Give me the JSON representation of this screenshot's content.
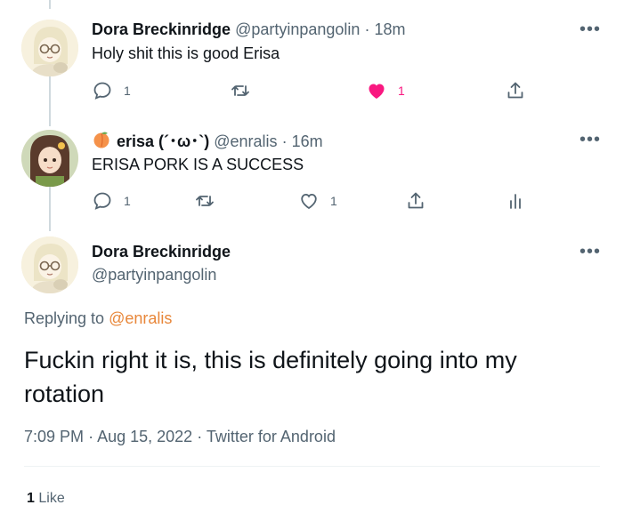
{
  "tweets": [
    {
      "name": "Dora Breckinridge",
      "handle": "@partyinpangolin",
      "time": "18m",
      "text": "Holy shit this is good Erisa",
      "replies": "1",
      "likes": "1",
      "liked": true
    },
    {
      "name": "erisa (´･ω･`)",
      "handle": "@enralis",
      "time": "16m",
      "text": "ERISA PORK IS A SUCCESS",
      "replies": "1",
      "likes": "1",
      "liked": false
    }
  ],
  "focused": {
    "name": "Dora Breckinridge",
    "handle": "@partyinpangolin",
    "replying_prefix": "Replying to",
    "replying_to": "@enralis",
    "text": "Fuckin right it is, this is definitely going into my rotation",
    "time": "7:09 PM",
    "date": "Aug 15, 2022",
    "source": "Twitter for Android",
    "like_count": "1",
    "like_label": "Like"
  },
  "separator": "·",
  "more": "•••",
  "colors": {
    "like_active": "#f91880",
    "mention": "#e8873a",
    "secondary_text": "#536471"
  }
}
